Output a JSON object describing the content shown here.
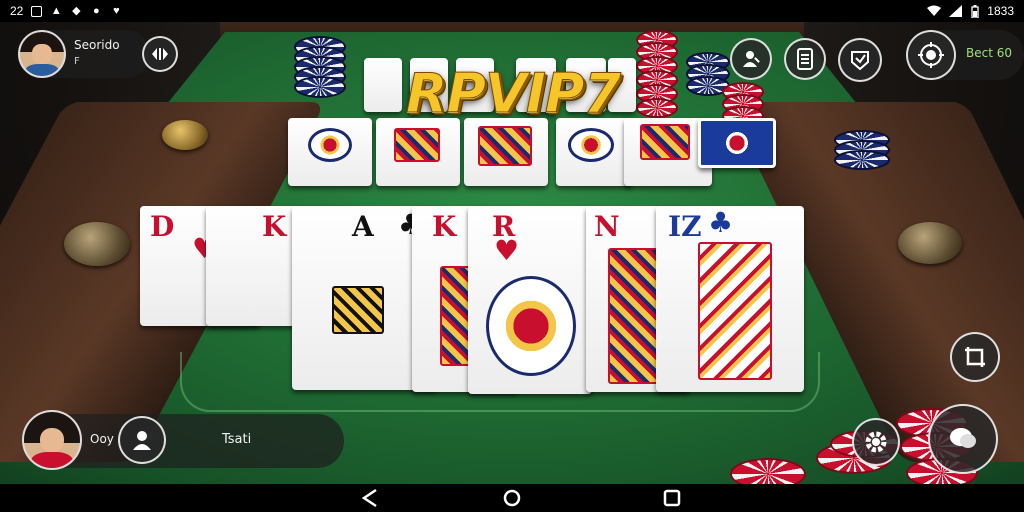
{
  "status_bar": {
    "left_text": "22",
    "time": "1833",
    "left_icons": [
      "square-notification-icon",
      "image-icon",
      "rupee-icon",
      "shield-icon",
      "heart-icon"
    ],
    "right_icons": [
      "wifi-icon",
      "signal-icon",
      "battery-icon"
    ]
  },
  "game": {
    "title": "RPVIP7"
  },
  "player_top": {
    "name": "Seorido",
    "sub": "F",
    "icon": "avatar-male"
  },
  "player_bottom": {
    "label": "Ooy",
    "name": "Tsati",
    "icon": "avatar-female"
  },
  "top_right": {
    "balance_label": "Bect 60"
  },
  "hud_buttons": {
    "top": [
      "swap-icon",
      "user-block-icon",
      "menu-list-icon",
      "shield-check-icon",
      "target-icon"
    ],
    "right": [
      "crop-frame-icon",
      "settings-gear-icon",
      "chat-bubble-icon"
    ],
    "bottom": [
      "add-friend-icon"
    ]
  },
  "cards": {
    "top_row_visible": [
      "",
      "",
      "",
      "",
      "",
      "back"
    ],
    "bottom_row": [
      {
        "rank": "D",
        "suit": "♥",
        "color": "red"
      },
      {
        "rank": "K",
        "suit": "♦",
        "color": "red"
      },
      {
        "rank": "A",
        "suit": "♣",
        "color": "black"
      },
      {
        "rank": "K",
        "suit": "♥",
        "color": "red"
      },
      {
        "rank": "R",
        "suit": "♥",
        "color": "red"
      },
      {
        "rank": "N",
        "suit": "",
        "color": "red"
      },
      {
        "rank": "IZ",
        "suit": "♣",
        "color": "blue"
      }
    ]
  },
  "colors": {
    "felt": "#1f6b33",
    "title_gold": "#f6c52a",
    "chip_red": "#c8102e",
    "chip_blue": "#1a2a6c"
  }
}
